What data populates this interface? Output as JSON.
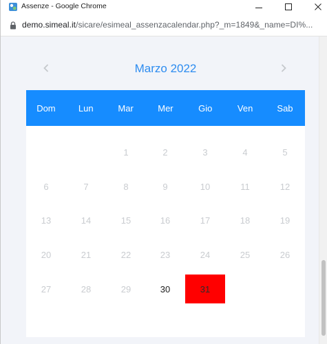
{
  "window": {
    "title": "Assenze - Google Chrome",
    "url_host": "demo.simeal.it",
    "url_path": "/sicare/esimeal_assenzacalendar.php?_m=1849&_name=DI%..."
  },
  "calendar": {
    "month_title": "Marzo 2022",
    "prev_icon": "chevron-left-icon",
    "next_icon": "chevron-right-icon",
    "weekdays": [
      "Dom",
      "Lun",
      "Mar",
      "Mer",
      "Gio",
      "Ven",
      "Sab"
    ],
    "weeks": [
      [
        "",
        "",
        "1",
        "2",
        "3",
        "4",
        "5"
      ],
      [
        "6",
        "7",
        "8",
        "9",
        "10",
        "11",
        "12"
      ],
      [
        "13",
        "14",
        "15",
        "16",
        "17",
        "18",
        "19"
      ],
      [
        "20",
        "21",
        "22",
        "23",
        "24",
        "25",
        "26"
      ],
      [
        "27",
        "28",
        "29",
        "30",
        "31",
        "",
        ""
      ]
    ],
    "active_days": [
      "30",
      "31"
    ],
    "marked_days": [
      "31"
    ],
    "colors": {
      "header": "#168cff",
      "month_title": "#2d8cf0",
      "marked": "#ff0000",
      "disabled_text": "#c9ccd0"
    }
  }
}
